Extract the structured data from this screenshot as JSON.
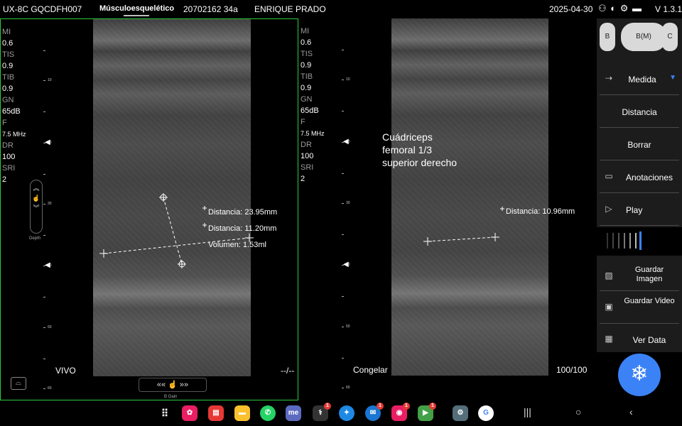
{
  "status_bar": {
    "device": "UX-8C GQCDFH007",
    "exam": "Músculoesquelético",
    "patient_id": "20702162 34a",
    "patient_name": "ENRIQUE PRADO",
    "date": "2025-04-30",
    "icons": "⚇ ◐ ⚙ ▬",
    "version": "V 1.3.1"
  },
  "left_image": {
    "params": [
      {
        "k": "MI",
        "v": "0.6"
      },
      {
        "k": "TIS",
        "v": "0.9"
      },
      {
        "k": "TIB",
        "v": "0.9"
      },
      {
        "k": "GN",
        "v": "65dB"
      },
      {
        "k": "F",
        "v": "7.5 MHz"
      },
      {
        "k": "DR",
        "v": "100"
      },
      {
        "k": "SRI",
        "v": "2"
      }
    ],
    "depth_ticks": [
      "10",
      "20",
      "30",
      "40",
      "50",
      "60"
    ],
    "depth_label": "Depth",
    "measurements": [
      "Distancia: 23.95mm",
      "Distancia: 11.20mm",
      "Volumen: 1.53ml"
    ],
    "status": "VIVO",
    "status_right": "--/--",
    "bgain_controls": "«« ☝ »»",
    "bgain_label": "B Gain"
  },
  "right_image": {
    "params": [
      {
        "k": "MI",
        "v": "0.6"
      },
      {
        "k": "TIS",
        "v": "0.9"
      },
      {
        "k": "TIB",
        "v": "0.9"
      },
      {
        "k": "GN",
        "v": "65dB"
      },
      {
        "k": "F",
        "v": "7.5 MHz"
      },
      {
        "k": "DR",
        "v": "100"
      },
      {
        "k": "SRI",
        "v": "2"
      }
    ],
    "annotation": [
      "Cuádriceps",
      "femoral 1/3",
      "superior derecho"
    ],
    "measurement": "Distancia: 10.96mm",
    "status": "Congelar",
    "frames": "100/100"
  },
  "sidebar": {
    "modes": [
      "B",
      "B(M)",
      "C"
    ],
    "items": [
      {
        "icon": "⇢",
        "label": "Medida"
      },
      {
        "icon": "",
        "label": "Distancia"
      },
      {
        "icon": "",
        "label": "Borrar"
      },
      {
        "icon": "▭",
        "label": "Anotaciones"
      },
      {
        "icon": "▷",
        "label": "Play"
      },
      {
        "icon": "▨",
        "label": "Guardar Imagen"
      },
      {
        "icon": "▣",
        "label": "Guardar Video"
      },
      {
        "icon": "▦",
        "label": "Ver Data"
      }
    ],
    "freeze_icon": "❄",
    "accent": "#3b82f6"
  },
  "navbar": {
    "apps": [
      {
        "name": "apps-grid-icon",
        "glyph": "⠿",
        "color": "#000000"
      },
      {
        "name": "flower-app-icon",
        "glyph": "✿",
        "color": "#e91e63"
      },
      {
        "name": "notes-app-icon",
        "glyph": "▤",
        "color": "#e53935"
      },
      {
        "name": "files-app-icon",
        "glyph": "▬",
        "color": "#fbc02d"
      },
      {
        "name": "whatsapp-icon",
        "glyph": "✆",
        "color": "#25d366"
      },
      {
        "name": "me-app-icon",
        "glyph": "me",
        "color": "#5c6bc0"
      },
      {
        "name": "ultrasound-app-icon",
        "glyph": "⚕",
        "color": "#333333",
        "badge": "1"
      },
      {
        "name": "assistant-app-icon",
        "glyph": "✦",
        "color": "#1e88e5"
      },
      {
        "name": "messages-app-icon",
        "glyph": "✉",
        "color": "#1976d2",
        "badge": "1"
      },
      {
        "name": "camera-app-icon",
        "glyph": "◉",
        "color": "#e91e63",
        "badge": "1"
      },
      {
        "name": "play-store-icon",
        "glyph": "▶",
        "color": "#43a047",
        "badge": "1"
      },
      {
        "name": "settings-app-icon",
        "glyph": "⚙",
        "color": "#546e7a"
      },
      {
        "name": "google-app-icon",
        "glyph": "G",
        "color": "#ffffff"
      }
    ],
    "keys": [
      "|||",
      "○",
      "‹"
    ]
  }
}
